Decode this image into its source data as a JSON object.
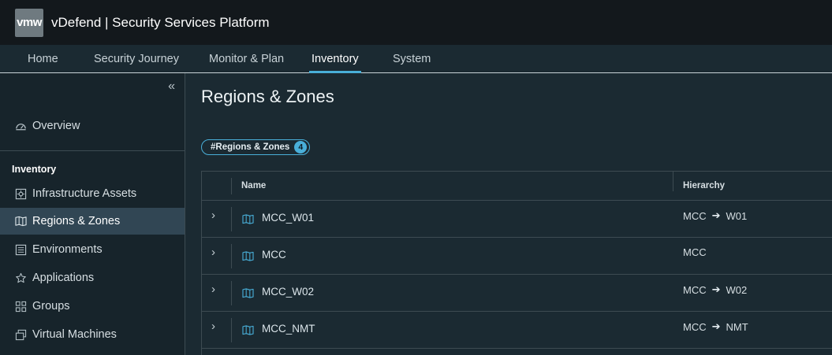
{
  "header": {
    "logo_text": "vmw",
    "app_title": "vDefend | Security Services Platform"
  },
  "nav": {
    "tabs": [
      {
        "label": "Home"
      },
      {
        "label": "Security Journey"
      },
      {
        "label": "Monitor & Plan"
      },
      {
        "label": "Inventory",
        "active": true
      },
      {
        "label": "System"
      }
    ]
  },
  "sidebar": {
    "collapse_icon": "double-chevron-left-icon",
    "overview": {
      "label": "Overview",
      "icon": "dashboard-icon"
    },
    "section_heading": "Inventory",
    "items": [
      {
        "label": "Infrastructure Assets",
        "icon": "infrastructure-icon"
      },
      {
        "label": "Regions & Zones",
        "icon": "map-icon",
        "active": true
      },
      {
        "label": "Environments",
        "icon": "environment-icon"
      },
      {
        "label": "Applications",
        "icon": "applications-icon"
      },
      {
        "label": "Groups",
        "icon": "groups-icon"
      },
      {
        "label": "Virtual Machines",
        "icon": "vm-icon"
      }
    ]
  },
  "main": {
    "title": "Regions & Zones",
    "filter_chip": {
      "label": "#Regions & Zones",
      "count": "4"
    },
    "table": {
      "columns": [
        "Name",
        "Hierarchy"
      ],
      "rows": [
        {
          "name": "MCC_W01",
          "hierarchy": [
            "MCC",
            "W01"
          ]
        },
        {
          "name": "MCC",
          "hierarchy": [
            "MCC"
          ]
        },
        {
          "name": "MCC_W02",
          "hierarchy": [
            "MCC",
            "W02"
          ]
        },
        {
          "name": "MCC_NMT",
          "hierarchy": [
            "MCC",
            "NMT"
          ]
        }
      ]
    }
  },
  "colors": {
    "accent": "#49afd9",
    "header_bg": "#13181c",
    "sidebar_bg": "#17242b",
    "content_bg": "#1b2a32",
    "active_item_bg": "#314654"
  }
}
